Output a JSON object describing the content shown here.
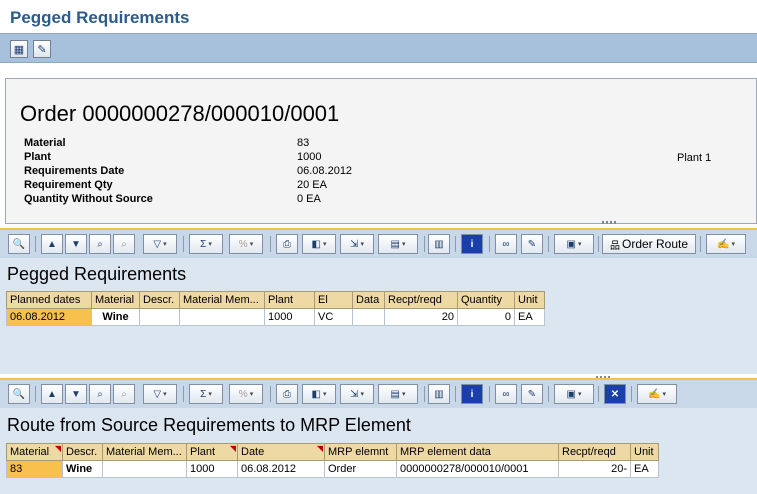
{
  "window": {
    "title": "Pegged Requirements"
  },
  "app_toolbar": {
    "buttons": [
      {
        "icon": "tree-expand-icon"
      },
      {
        "icon": "edit-icon"
      }
    ]
  },
  "header": {
    "order_title": "Order 0000000278/000010/0001",
    "fields": [
      {
        "label": "Material",
        "value": "83"
      },
      {
        "label": "Plant",
        "value": "1000"
      },
      {
        "label": "Requirements Date",
        "value": "06.08.2012"
      },
      {
        "label": "Requirement Qty",
        "value": "20 EA"
      },
      {
        "label": "Quantity Without Source",
        "value": "0 EA"
      }
    ],
    "plant_text": "Plant 1"
  },
  "pegged": {
    "toolbar": {
      "order_route_label": "Order Route"
    },
    "title": "Pegged Requirements",
    "columns": [
      "Planned dates",
      "Material",
      "Descr.",
      "Material Mem...",
      "Plant",
      "El",
      "Data",
      "Recpt/reqd",
      "Quantity",
      "Unit"
    ],
    "rows": [
      [
        "06.08.2012",
        "Wine",
        "",
        "",
        "1000",
        "VC",
        "",
        "20",
        "0",
        "EA"
      ]
    ]
  },
  "route": {
    "title": "Route from Source Requirements to MRP Element",
    "columns": [
      "Material",
      "Descr.",
      "Material Mem...",
      "Plant",
      "Date",
      "MRP elemnt",
      "MRP element data",
      "Recpt/reqd",
      "Unit"
    ],
    "rows": [
      [
        "83",
        "Wine",
        "",
        "1000",
        "06.08.2012",
        "Order",
        "0000000278/000010/0001",
        "20-",
        "EA"
      ]
    ]
  },
  "colors": {
    "title_blue": "#2b5c8a",
    "toolbar_blue": "#a7c1dd",
    "grid_header": "#eed8a4",
    "key_cell": "#f8c04c",
    "panel_blue": "#dce6f1"
  }
}
